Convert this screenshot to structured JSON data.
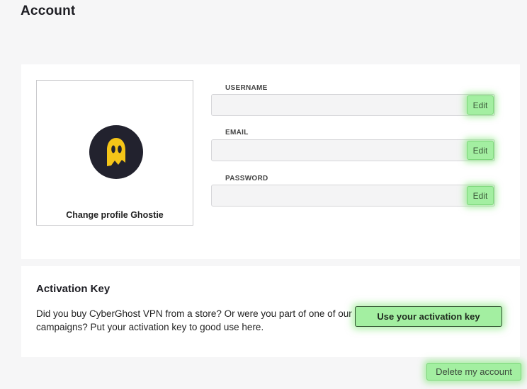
{
  "page": {
    "title": "Account"
  },
  "profile": {
    "change_label": "Change profile Ghostie",
    "avatar_icon": "ghost-icon",
    "avatar_bg": "#22222e",
    "avatar_fg": "#f5c518"
  },
  "fields": [
    {
      "label": "USERNAME",
      "value": "",
      "edit_label": "Edit"
    },
    {
      "label": "EMAIL",
      "value": "",
      "edit_label": "Edit"
    },
    {
      "label": "PASSWORD",
      "value": "",
      "edit_label": "Edit"
    }
  ],
  "activation": {
    "title": "Activation Key",
    "description": "Did you buy CyberGhost VPN from a store? Or were you part of one of our campaigns? Put your activation key to good use here.",
    "button_label": "Use your activation key"
  },
  "delete_label": "Delete my account",
  "colors": {
    "highlight": "#a3efa1",
    "card_bg": "#ffffff",
    "page_bg": "#f6f6f7"
  }
}
